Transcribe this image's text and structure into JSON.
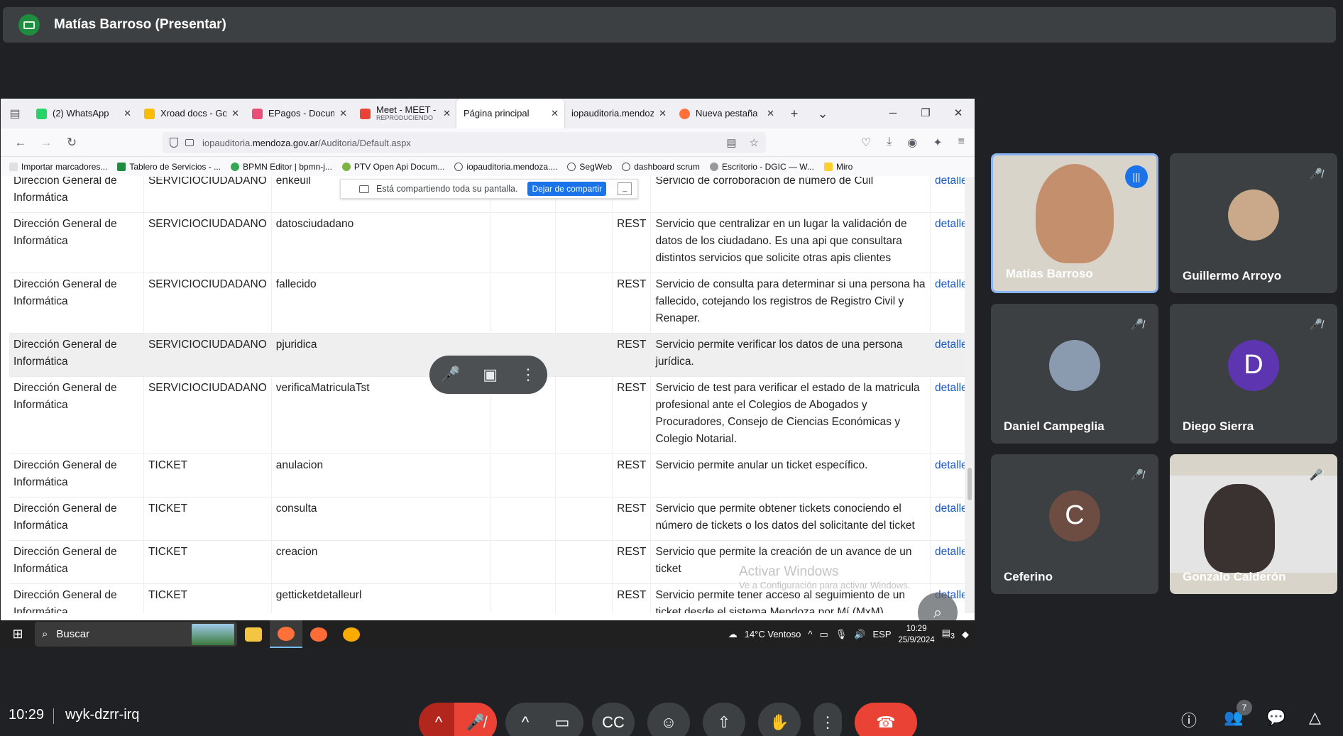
{
  "presenter": {
    "name": "Matías Barroso (Presentar)"
  },
  "browser": {
    "tabs": [
      {
        "label": "(2) WhatsApp",
        "color": "#25d366"
      },
      {
        "label": "Xroad docs - Goo",
        "color": "#fbbc04"
      },
      {
        "label": "EPagos - Docume",
        "color": "#e94e77"
      },
      {
        "label": "Meet - MEET - Su",
        "sub": "REPRODUCIENDO",
        "color": "#ea4335"
      },
      {
        "label": "Página principal",
        "color": ""
      },
      {
        "label": "iopauditoria.mendoza",
        "color": ""
      },
      {
        "label": "Nueva pestaña",
        "color": "#ff7139"
      }
    ],
    "url_prefix": "iopauditoria.",
    "url_domain": "mendoza.gov.ar",
    "url_path": "/Auditoria/Default.aspx",
    "bookmarks": [
      "Importar marcadores...",
      "Tablero de Servicios - ...",
      "BPMN Editor | bpmn-j...",
      "PTV Open Api Docum...",
      "iopauditoria.mendoza....",
      "SegWeb",
      "dashboard scrum",
      "Escritorio - DGIC — W...",
      "Miro"
    ]
  },
  "share_notice": {
    "text": "Está compartiendo toda su pantalla.",
    "button": "Dejar de compartir"
  },
  "table": {
    "rows": [
      {
        "org": "Dirección General de Informática",
        "cat": "SERVICIOCIUDADANO",
        "svc": "enkeuil",
        "type": "",
        "desc": "Servicio de corroboración de número de Cuil",
        "link": "detalle",
        "hl": false
      },
      {
        "org": "Dirección General de Informática",
        "cat": "SERVICIOCIUDADANO",
        "svc": "datosciudadano",
        "type": "REST",
        "desc": "Servicio que centralizar en un lugar la validación de datos de los ciudadano. Es una api que consultara distintos servicios que solicite otras apis clientes",
        "link": "detalle",
        "hl": false
      },
      {
        "org": "Dirección General de Informática",
        "cat": "SERVICIOCIUDADANO",
        "svc": "fallecido",
        "type": "REST",
        "desc": "Servicio de consulta para determinar si una persona ha fallecido, cotejando los registros de Registro Civil y Renaper.",
        "link": "detalle",
        "hl": false
      },
      {
        "org": "Dirección General de Informática",
        "cat": "SERVICIOCIUDADANO",
        "svc": "pjuridica",
        "type": "REST",
        "desc": "Servicio permite verificar los datos de una persona jurídica.",
        "link": "detalle",
        "hl": true
      },
      {
        "org": "Dirección General de Informática",
        "cat": "SERVICIOCIUDADANO",
        "svc": "verificaMatriculaTst",
        "type": "REST",
        "desc": "Servicio de test para verificar el estado de la matricula profesional ante el Colegios de Abogados y Procuradores, Consejo de Ciencias Económicas y Colegio Notarial.",
        "link": "detalle",
        "hl": false
      },
      {
        "org": "Dirección General de Informática",
        "cat": "TICKET",
        "svc": "anulacion",
        "type": "REST",
        "desc": "Servicio permite anular un ticket específico.",
        "link": "detalle",
        "hl": false
      },
      {
        "org": "Dirección General de Informática",
        "cat": "TICKET",
        "svc": "consulta",
        "type": "REST",
        "desc": "Servicio que permite obtener tickets conociendo el número de tickets o los datos del solicitante del ticket",
        "link": "detalle",
        "hl": false
      },
      {
        "org": "Dirección General de Informática",
        "cat": "TICKET",
        "svc": "creacion",
        "type": "REST",
        "desc": "Servicio que permite la creación de un avance de un ticket",
        "link": "detalle",
        "hl": false
      },
      {
        "org": "Dirección General de Informática",
        "cat": "TICKET",
        "svc": "getticketdetalleurl",
        "type": "REST",
        "desc": "Servicio permite tener acceso al seguimiento de un ticket desde el sistema Mendoza por Mí (MxM).",
        "link": "detalle",
        "hl": false
      }
    ]
  },
  "watermark": {
    "title": "Activar Windows",
    "sub": "Ve a Configuración para activar Windows."
  },
  "taskbar": {
    "search_placeholder": "Buscar",
    "weather": "14°C  Ventoso",
    "lang": "ESP",
    "time": "10:29",
    "date": "25/9/2024",
    "notif_count": "3"
  },
  "participants": [
    {
      "name": "Matías Barroso",
      "initial": "",
      "avatar_color": "",
      "video": true,
      "speaking": true
    },
    {
      "name": "Guillermo Arroyo",
      "initial": "",
      "avatar_color": "#c9a98a",
      "video": false,
      "speaking": false
    },
    {
      "name": "Daniel Campeglia",
      "initial": "",
      "avatar_color": "#8a9bb0",
      "video": false,
      "speaking": false
    },
    {
      "name": "Diego Sierra",
      "initial": "D",
      "avatar_color": "#5e35b1",
      "video": false,
      "speaking": false
    },
    {
      "name": "Ceferino",
      "initial": "C",
      "avatar_color": "#6d4c41",
      "video": false,
      "speaking": false
    },
    {
      "name": "Gonzalo Calderón",
      "initial": "",
      "avatar_color": "",
      "video": true,
      "speaking": false
    }
  ],
  "meeting": {
    "time": "10:29",
    "code": "wyk-dzrr-irq",
    "people_count": "7"
  }
}
